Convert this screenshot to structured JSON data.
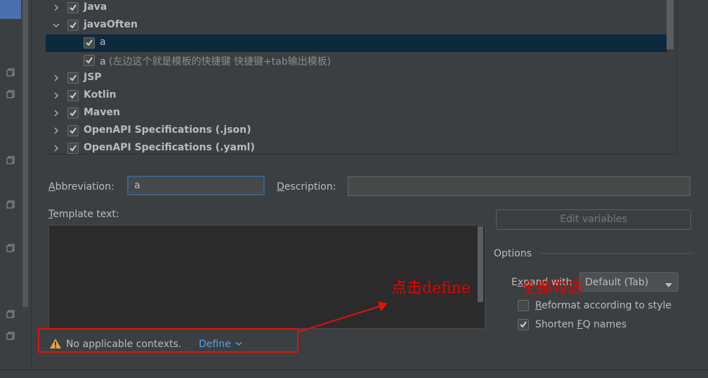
{
  "tree": {
    "rows": [
      {
        "label": "Java",
        "bold": true,
        "expandable": true,
        "expanded": false,
        "checked": true,
        "child": false,
        "selected": false
      },
      {
        "label": "javaOften",
        "bold": true,
        "expandable": true,
        "expanded": true,
        "checked": true,
        "child": false,
        "selected": false
      },
      {
        "label": "a",
        "bold": false,
        "expandable": false,
        "checked": true,
        "child": true,
        "selected": true,
        "description": ""
      },
      {
        "label": "a",
        "bold": false,
        "expandable": false,
        "checked": true,
        "child": true,
        "selected": false,
        "description": " (左边这个就是模板的快捷键  快捷键+tab输出模板)"
      },
      {
        "label": "JSP",
        "bold": true,
        "expandable": true,
        "expanded": false,
        "checked": true,
        "child": false,
        "selected": false
      },
      {
        "label": "Kotlin",
        "bold": true,
        "expandable": true,
        "expanded": false,
        "checked": true,
        "child": false,
        "selected": false
      },
      {
        "label": "Maven",
        "bold": true,
        "expandable": true,
        "expanded": false,
        "checked": true,
        "child": false,
        "selected": false
      },
      {
        "label": "OpenAPI Specifications (.json)",
        "bold": true,
        "expandable": true,
        "expanded": false,
        "checked": true,
        "child": false,
        "selected": false
      },
      {
        "label": "OpenAPI Specifications (.yaml)",
        "bold": true,
        "expandable": true,
        "expanded": false,
        "checked": true,
        "child": false,
        "selected": false
      }
    ]
  },
  "form": {
    "abbreviation_label_mn": "A",
    "abbreviation_label_rest": "bbreviation:",
    "abbreviation_value": "a",
    "description_label_mn": "D",
    "description_label_rest": "escription:",
    "description_value": "",
    "template_label_mn": "T",
    "template_label_rest": "emplate text:",
    "template_value": "",
    "edit_variables": "Edit variables"
  },
  "options": {
    "title": "Options",
    "expand_label_pre": "E",
    "expand_label_mn": "x",
    "expand_label_rest": "pand with",
    "expand_value": "Default (Tab)",
    "reformat_label_mn": "R",
    "reformat_label_rest": "eformat according to style",
    "reformat_checked": false,
    "shorten_label_pre": "Shorten ",
    "shorten_label_mn": "F",
    "shorten_label_rest": "Q names",
    "shorten_checked": true
  },
  "context": {
    "warning": "No applicable contexts.",
    "define": "Define"
  },
  "annotations": {
    "text_1": "点击define",
    "text_2": "全部勾选",
    "color": "#e80000"
  },
  "colors": {
    "background": "#3c3f41",
    "selection": "#0d293e",
    "link": "#589df6",
    "warning": "#e8a33d"
  }
}
